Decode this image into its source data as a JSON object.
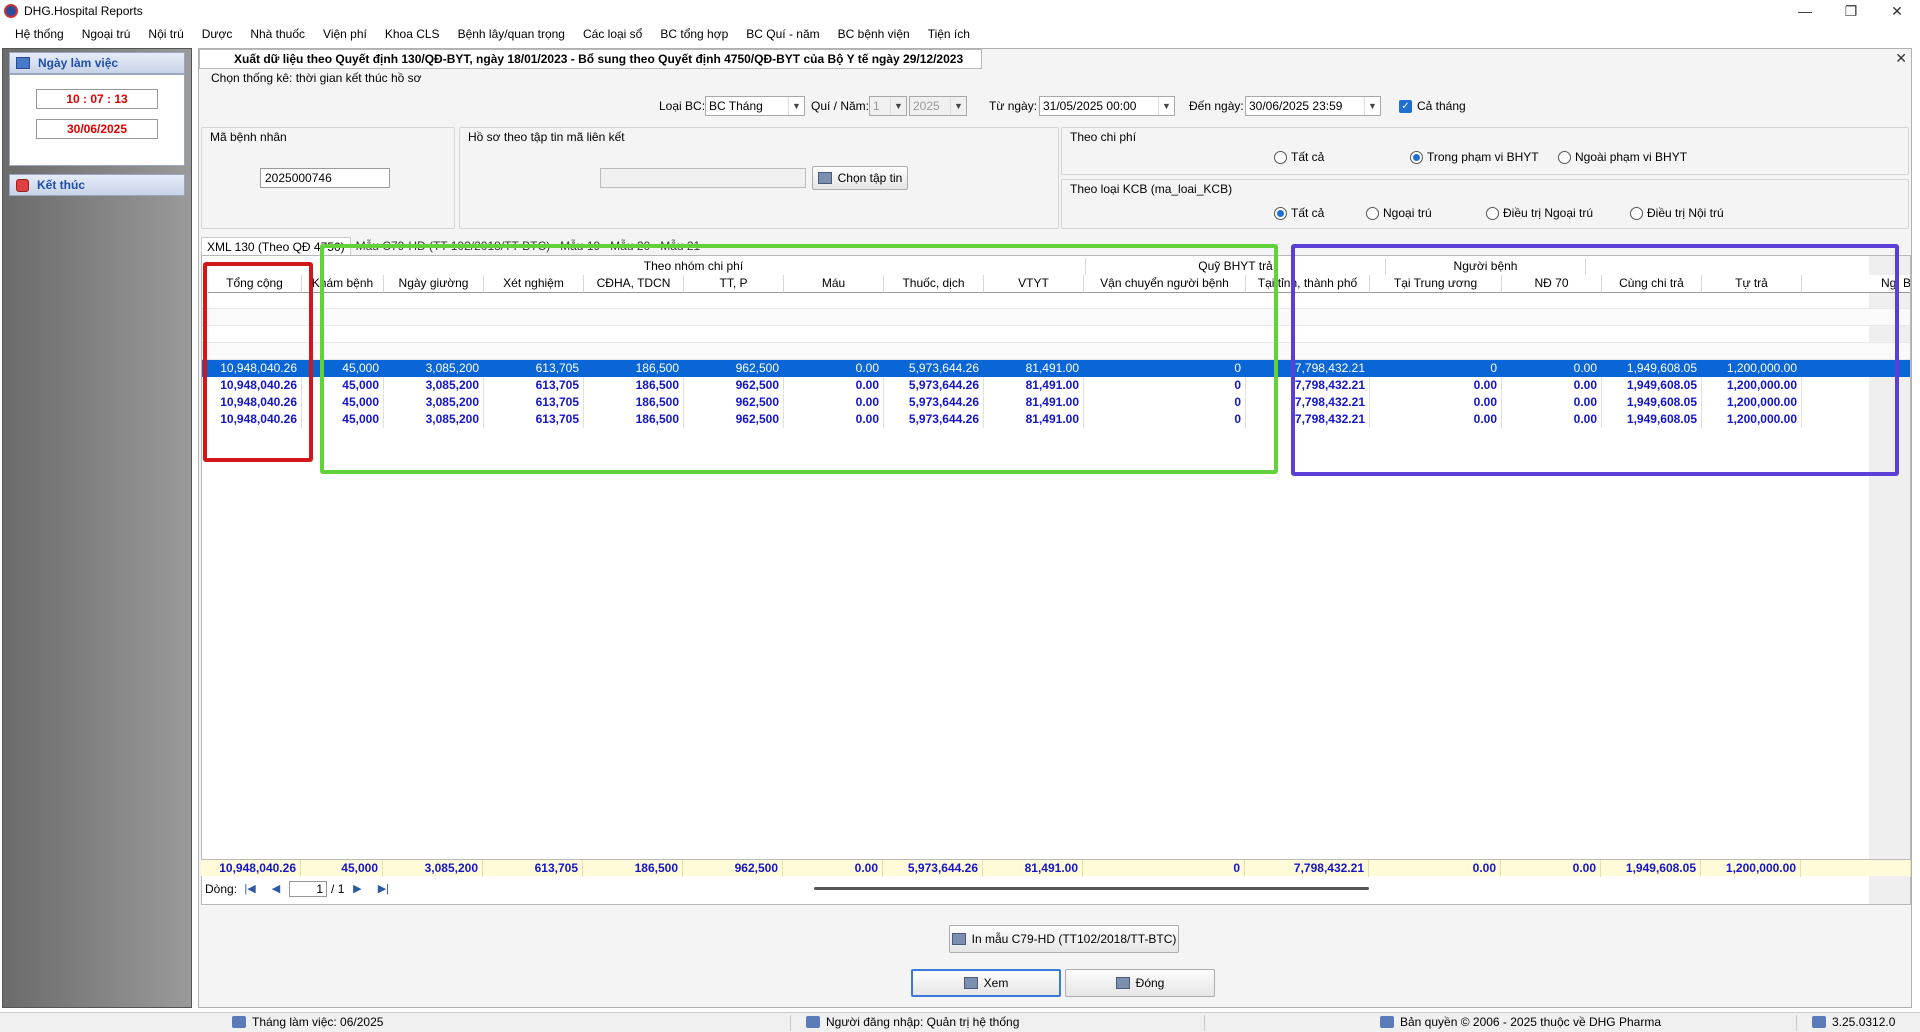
{
  "window": {
    "title": "DHG.Hospital Reports",
    "minimize": "—",
    "restore": "❐",
    "close": "✕"
  },
  "menu": [
    "Hệ thống",
    "Ngoại trú",
    "Nội trú",
    "Dược",
    "Nhà thuốc",
    "Viện phí",
    "Khoa CLS",
    "Bệnh lây/quan trọng",
    "Các loại sổ",
    "BC tổng hợp",
    "BC Quí - năm",
    "BC bệnh viện",
    "Tiện ích"
  ],
  "sidebar": {
    "workday_header": "Ngày làm việc",
    "time": "10 : 07 : 13",
    "date": "30/06/2025",
    "exit_label": "Kết thúc"
  },
  "report": {
    "title": "Xuất dữ liệu theo Quyết định 130/QĐ-BYT, ngày 18/01/2023 - Bổ sung theo Quyết định 4750/QĐ-BYT của Bộ Y tế ngày 29/12/2023",
    "close": "✕",
    "stat_note": "Chọn thống kê: thời gian kết thúc hồ sơ",
    "report_type_label": "Loại BC:",
    "report_type_value": "BC Tháng",
    "quarter_year_label": "Quí / Năm:",
    "quarter_value": "1",
    "year_value": "2025",
    "from_label": "Từ ngày:",
    "from_value": "31/05/2025 00:00",
    "to_label": "Đến ngày:",
    "to_value": "30/06/2025 23:59",
    "whole_month_label": "Cả tháng",
    "whole_month_checked": true,
    "patient_group_label": "Mã bệnh nhân",
    "patient_id": "2025000746",
    "file_group_label": "Hồ sơ theo tập tin mã liên kết",
    "file_path": "",
    "choose_file_label": "Chọn tập tin",
    "cost_group_label": "Theo chi phí",
    "cost_options": [
      "Tất cả",
      "Trong phạm vi BHYT",
      "Ngoài phạm vi BHYT"
    ],
    "cost_selected": 1,
    "kcb_group_label": "Theo loại KCB (ma_loai_KCB)",
    "kcb_options": [
      "Tất cả",
      "Ngoại trú",
      "Điều trị Ngoại trú",
      "Điều trị Nội trú"
    ],
    "kcb_selected": 0
  },
  "tabs": [
    "XML 130 (Theo QĐ 4750)",
    "Mẫu C79-HD (TT 102/2018/TT-BTC)",
    "Mẫu 19",
    "Mẫu 20",
    "Mẫu 21"
  ],
  "grid": {
    "group_headers": {
      "cost_group": "Theo nhóm chi phí",
      "bhyt_group": "Quỹ BHYT trả",
      "patient_group": "Người bệnh"
    },
    "columns": [
      "Tổng cộng",
      "Khám bệnh",
      "Ngày giường",
      "Xét nghiệm",
      "CĐHA, TDCN",
      "TT, P",
      "Máu",
      "Thuốc, dịch",
      "VTYT",
      "Vận chuyển người bệnh",
      "Tại tỉnh, thành phố",
      "Tại Trung ương",
      "NĐ 70",
      "Cùng chi trả",
      "Tự trả",
      "Ng. B"
    ],
    "rows": [
      [
        "10,948,040.26",
        "45,000",
        "3,085,200",
        "613,705",
        "186,500",
        "962,500",
        "0.00",
        "5,973,644.26",
        "81,491.00",
        "0",
        "7,798,432.21",
        "0",
        "0.00",
        "1,949,608.05",
        "1,200,000.00",
        ""
      ],
      [
        "10,948,040.26",
        "45,000",
        "3,085,200",
        "613,705",
        "186,500",
        "962,500",
        "0.00",
        "5,973,644.26",
        "81,491.00",
        "0",
        "7,798,432.21",
        "0.00",
        "0.00",
        "1,949,608.05",
        "1,200,000.00",
        ""
      ],
      [
        "10,948,040.26",
        "45,000",
        "3,085,200",
        "613,705",
        "186,500",
        "962,500",
        "0.00",
        "5,973,644.26",
        "81,491.00",
        "0",
        "7,798,432.21",
        "0.00",
        "0.00",
        "1,949,608.05",
        "1,200,000.00",
        ""
      ],
      [
        "10,948,040.26",
        "45,000",
        "3,085,200",
        "613,705",
        "186,500",
        "962,500",
        "0.00",
        "5,973,644.26",
        "81,491.00",
        "0",
        "7,798,432.21",
        "0.00",
        "0.00",
        "1,949,608.05",
        "1,200,000.00",
        ""
      ]
    ],
    "totals": [
      "10,948,040.26",
      "45,000",
      "3,085,200",
      "613,705",
      "186,500",
      "962,500",
      "0.00",
      "5,973,644.26",
      "81,491.00",
      "0",
      "7,798,432.21",
      "0.00",
      "0.00",
      "1,949,608.05",
      "1,200,000.00",
      ""
    ]
  },
  "pager": {
    "rows_label": "Dòng:",
    "current_page": "1",
    "total_pages": "/ 1"
  },
  "actions": {
    "print_label": "In mẫu C79-HD (TT102/2018/TT-BTC)",
    "view_label": "Xem",
    "close_label": "Đóng"
  },
  "status": {
    "month": "Tháng làm việc: 06/2025",
    "user": "Người đăng nhập: Quản trị hệ thống",
    "copyright": "Bản quyền © 2006 - 2025 thuộc về DHG Pharma",
    "version": "3.25.0312.0"
  },
  "colors": {
    "selected_row": "#0a66d6",
    "bold_text": "#1414c8",
    "highlight_red": "#d01818",
    "highlight_green": "#62d23a",
    "highlight_purple": "#5b3fd6"
  }
}
